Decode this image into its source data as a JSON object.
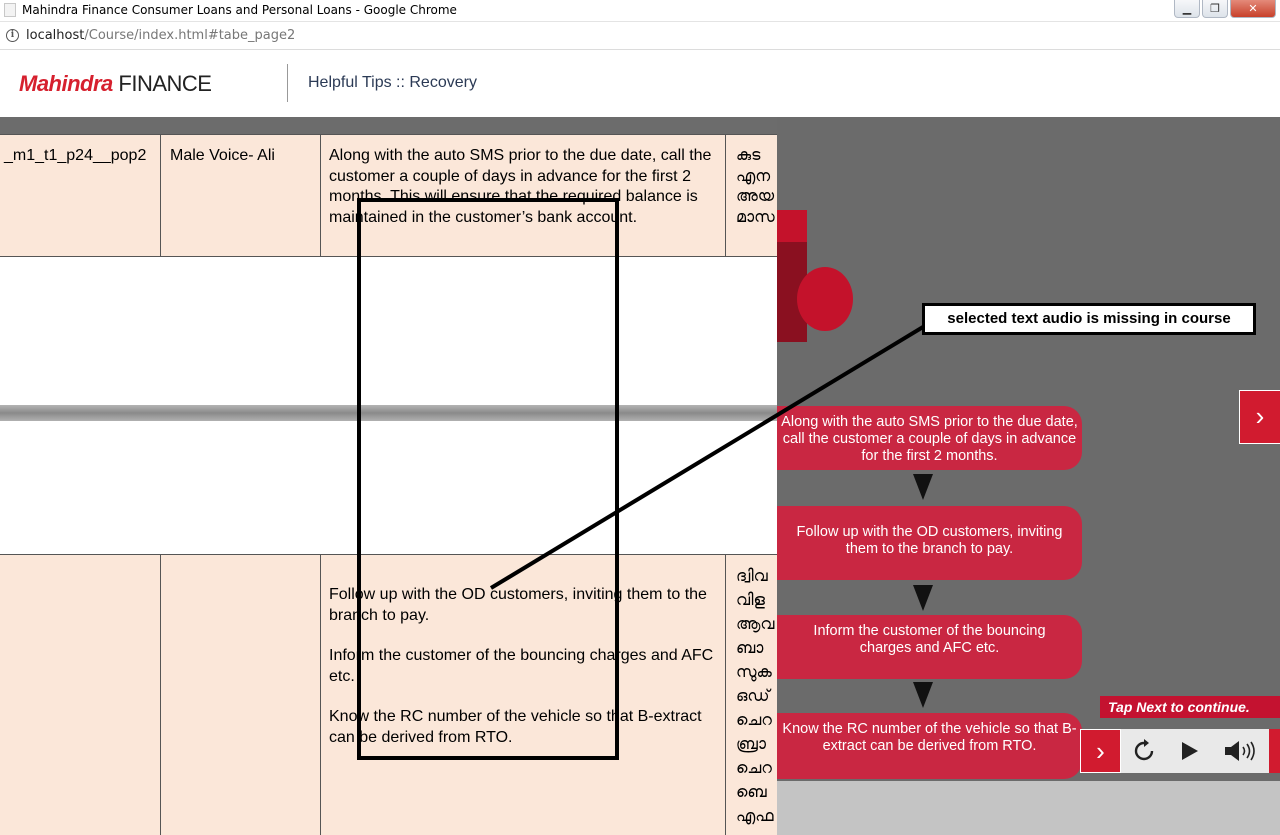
{
  "browser": {
    "window_title": "Mahindra Finance Consumer Loans and Personal Loans - Google Chrome",
    "url_host": "localhost",
    "url_path": "/Course/index.html#tabe_page2",
    "window_controls": [
      "minimize",
      "restore",
      "close"
    ]
  },
  "header": {
    "logo_mahindra": "Mahindra",
    "logo_finance": "FINANCE",
    "page_title": "Helpful Tips :: Recovery"
  },
  "table": {
    "row1": {
      "id": "_m1_t1_p24__pop2",
      "voice": "Male Voice- Ali",
      "english": "Along with the auto SMS prior to the due date, call the customer a couple of days in advance for the first 2 months. This will ensure that the required balance is maintained in the customer’s bank account.",
      "malayalam": "കുട\nഎന\nഅയ\nമാസ"
    },
    "row2": {
      "para1": "Follow up with the OD customers, inviting them to the branch to pay.",
      "para2": "Inform the customer of the bouncing charges and AFC etc.",
      "para3": "Know the RC number of the vehicle so that B-extract can be derived from RTO.",
      "malayalam": "ദ്വിവ\nവിള\nആവ\nബാ\nസുക\nഒഡ്\nചെറ\nബ്രാ\nചെറ\nബെ\nഎഫ"
    }
  },
  "course": {
    "steps": [
      "Along with the auto SMS prior to the due date, call the customer a couple of days in advance for the first 2 months.",
      "Follow up with the OD customers, inviting them to the branch to pay.",
      "Inform the customer of the bouncing charges and AFC etc.",
      "Know the RC number of the vehicle so that B-extract can be derived from RTO."
    ],
    "tap_next": "Tap Next to continue.",
    "icons": {
      "side_next": "chevron-right-icon",
      "next": "chevron-right-icon",
      "reload": "reload-icon",
      "play": "play-icon",
      "sound": "speaker-icon"
    },
    "colors": {
      "accent": "#c92742",
      "panel_bg": "#6b6b6b",
      "table_bg": "#fbe7d9"
    }
  },
  "annotation": {
    "callout_text": "selected text audio is missing in course"
  }
}
